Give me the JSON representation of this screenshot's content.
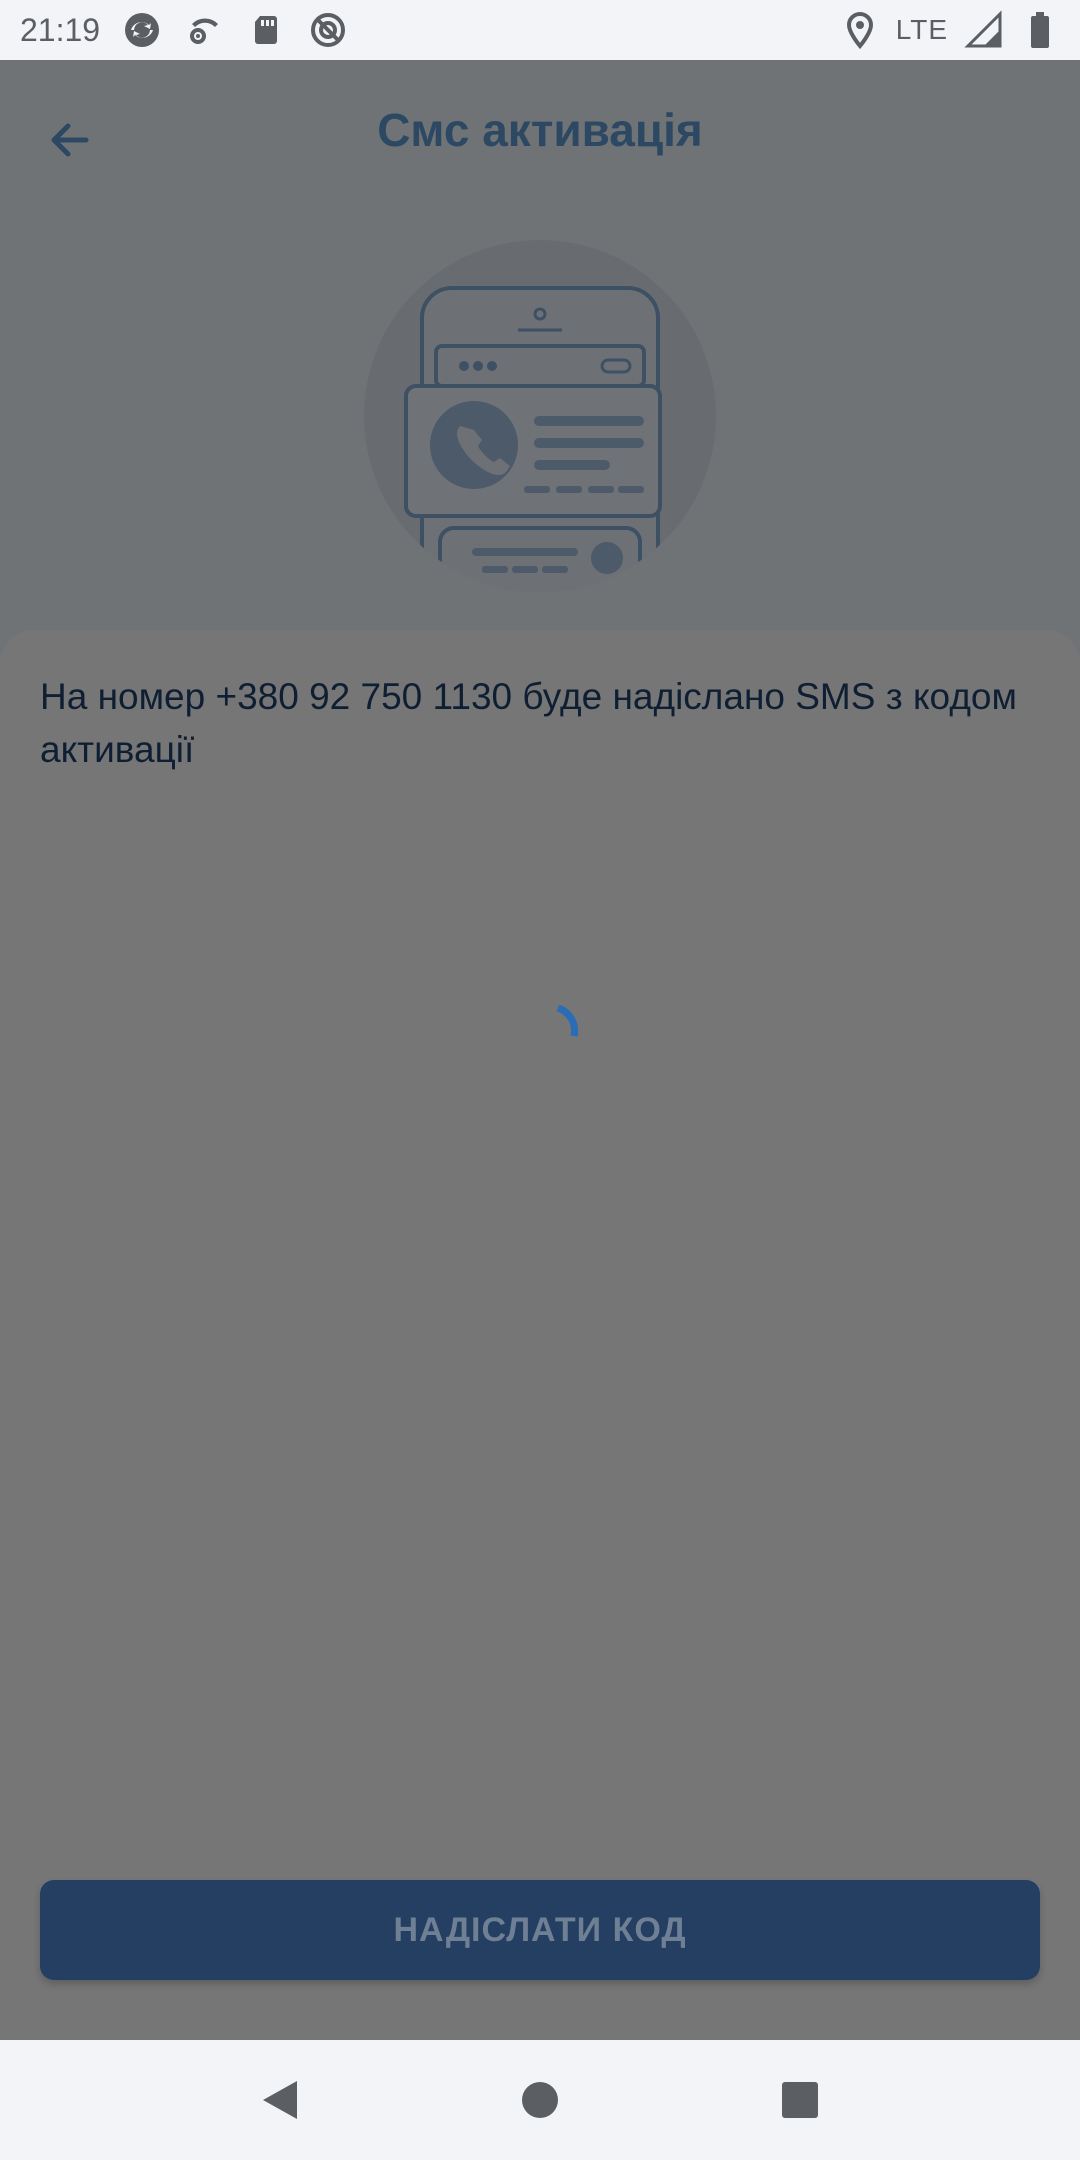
{
  "status_bar": {
    "time": "21:19",
    "network": "LTE",
    "icons": [
      "sync-icon",
      "wifi-settings-icon",
      "sd-card-icon",
      "do-not-disturb-icon",
      "location-icon",
      "signal-icon",
      "battery-icon"
    ]
  },
  "header": {
    "title": "Смс активація",
    "back_icon": "arrow-left-icon"
  },
  "illustration": {
    "icon": "phone-contact-card-illustration"
  },
  "content": {
    "message": "На номер +380 92 750 1130 буде надіслано SMS з кодом активації",
    "loading": true
  },
  "actions": {
    "send_code_label": "НАДІСЛАТИ КОД"
  },
  "nav_bar": {
    "icons": [
      "back-triangle-icon",
      "home-circle-icon",
      "recents-square-icon"
    ]
  },
  "colors": {
    "primary": "#243f61",
    "title": "#2c4862",
    "spinner": "#2a6cb5",
    "overlay": "#757575"
  }
}
